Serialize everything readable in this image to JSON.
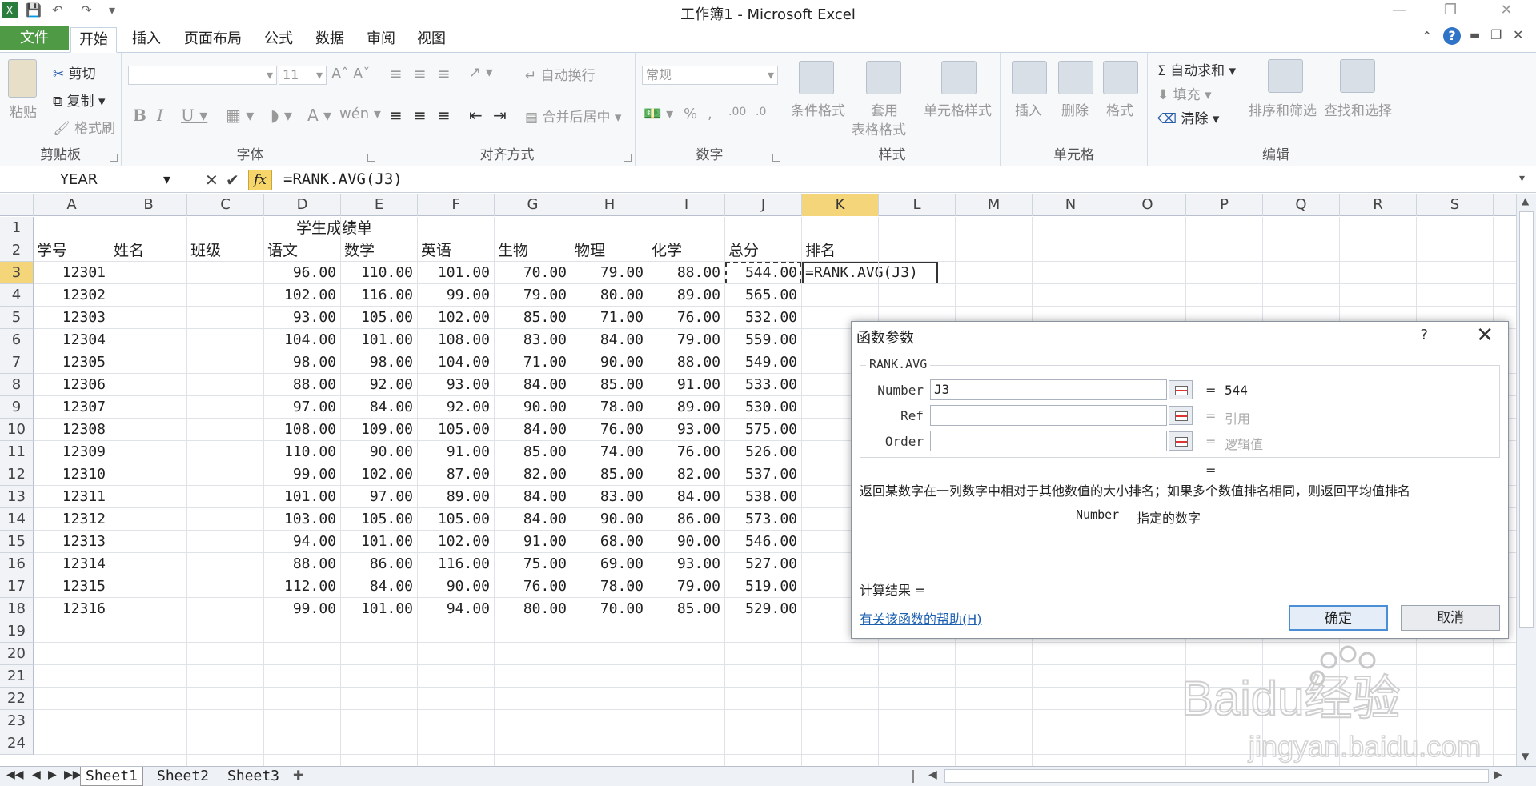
{
  "window": {
    "title": "工作簿1 - Microsoft Excel"
  },
  "tabs": [
    "文件",
    "开始",
    "插入",
    "页面布局",
    "公式",
    "数据",
    "审阅",
    "视图"
  ],
  "ribbon": {
    "clipboard": {
      "label": "剪贴板",
      "paste": "粘贴",
      "cut": "剪切",
      "copy": "复制",
      "format_painter": "格式刷"
    },
    "font": {
      "label": "字体",
      "size": "11"
    },
    "alignment": {
      "label": "对齐方式",
      "wrap": "自动换行",
      "merge": "合并后居中"
    },
    "number": {
      "label": "数字",
      "format": "常规"
    },
    "styles": {
      "label": "样式",
      "conditional": "条件格式",
      "table_line1": "套用",
      "table_line2": "表格格式",
      "cell_styles": "单元格样式"
    },
    "cells": {
      "label": "单元格",
      "insert": "插入",
      "delete": "删除",
      "format": "格式"
    },
    "editing": {
      "label": "编辑",
      "autosum": "自动求和",
      "fill": "填充",
      "clear": "清除",
      "sort": "排序和筛选",
      "find": "查找和选择"
    }
  },
  "formula_bar": {
    "name_box": "YEAR",
    "formula": "=RANK.AVG(J3)"
  },
  "columns": [
    "A",
    "B",
    "C",
    "D",
    "E",
    "F",
    "G",
    "H",
    "I",
    "J",
    "K",
    "L",
    "M",
    "N",
    "O",
    "P",
    "Q",
    "R",
    "S"
  ],
  "rows": [
    "1",
    "2",
    "3",
    "4",
    "5",
    "6",
    "7",
    "8",
    "9",
    "10",
    "11",
    "12",
    "13",
    "14",
    "15",
    "16",
    "17",
    "18",
    "19",
    "20",
    "21",
    "22",
    "23",
    "24"
  ],
  "sheet": {
    "title": "学生成绩单",
    "headers": [
      "学号",
      "姓名",
      "班级",
      "语文",
      "数学",
      "英语",
      "生物",
      "物理",
      "化学",
      "总分",
      "排名"
    ],
    "data": [
      [
        "12301",
        "96.00",
        "110.00",
        "101.00",
        "70.00",
        "79.00",
        "88.00",
        "544.00"
      ],
      [
        "12302",
        "102.00",
        "116.00",
        "99.00",
        "79.00",
        "80.00",
        "89.00",
        "565.00"
      ],
      [
        "12303",
        "93.00",
        "105.00",
        "102.00",
        "85.00",
        "71.00",
        "76.00",
        "532.00"
      ],
      [
        "12304",
        "104.00",
        "101.00",
        "108.00",
        "83.00",
        "84.00",
        "79.00",
        "559.00"
      ],
      [
        "12305",
        "98.00",
        "98.00",
        "104.00",
        "71.00",
        "90.00",
        "88.00",
        "549.00"
      ],
      [
        "12306",
        "88.00",
        "92.00",
        "93.00",
        "84.00",
        "85.00",
        "91.00",
        "533.00"
      ],
      [
        "12307",
        "97.00",
        "84.00",
        "92.00",
        "90.00",
        "78.00",
        "89.00",
        "530.00"
      ],
      [
        "12308",
        "108.00",
        "109.00",
        "105.00",
        "84.00",
        "76.00",
        "93.00",
        "575.00"
      ],
      [
        "12309",
        "110.00",
        "90.00",
        "91.00",
        "85.00",
        "74.00",
        "76.00",
        "526.00"
      ],
      [
        "12310",
        "99.00",
        "102.00",
        "87.00",
        "82.00",
        "85.00",
        "82.00",
        "537.00"
      ],
      [
        "12311",
        "101.00",
        "97.00",
        "89.00",
        "84.00",
        "83.00",
        "84.00",
        "538.00"
      ],
      [
        "12312",
        "103.00",
        "105.00",
        "105.00",
        "84.00",
        "90.00",
        "86.00",
        "573.00"
      ],
      [
        "12313",
        "94.00",
        "101.00",
        "102.00",
        "91.00",
        "68.00",
        "90.00",
        "546.00"
      ],
      [
        "12314",
        "88.00",
        "86.00",
        "116.00",
        "75.00",
        "69.00",
        "93.00",
        "527.00"
      ],
      [
        "12315",
        "112.00",
        "84.00",
        "90.00",
        "76.00",
        "78.00",
        "79.00",
        "519.00"
      ],
      [
        "12316",
        "99.00",
        "101.00",
        "94.00",
        "80.00",
        "70.00",
        "85.00",
        "529.00"
      ]
    ],
    "k3_formula": "=RANK.AVG(J3)"
  },
  "sheet_tabs": [
    "Sheet1",
    "Sheet2",
    "Sheet3"
  ],
  "dialog": {
    "title": "函数参数",
    "help_glyph": "?",
    "function_name": "RANK.AVG",
    "args": [
      {
        "label": "Number",
        "value": "J3",
        "result": "544"
      },
      {
        "label": "Ref",
        "value": "",
        "result": "引用"
      },
      {
        "label": "Order",
        "value": "",
        "result": "逻辑值"
      }
    ],
    "eq": "=",
    "description": "返回某数字在一列数字中相对于其他数值的大小排名；如果多个数值排名相同，则返回平均值排名",
    "arg_desc_name": "Number",
    "arg_desc": "指定的数字",
    "calc_result": "计算结果 =",
    "help_link": "有关该函数的帮助(H)",
    "ok": "确定",
    "cancel": "取消"
  },
  "watermark": {
    "text": "Baidu经验",
    "url": "jingyan.baidu.com"
  }
}
